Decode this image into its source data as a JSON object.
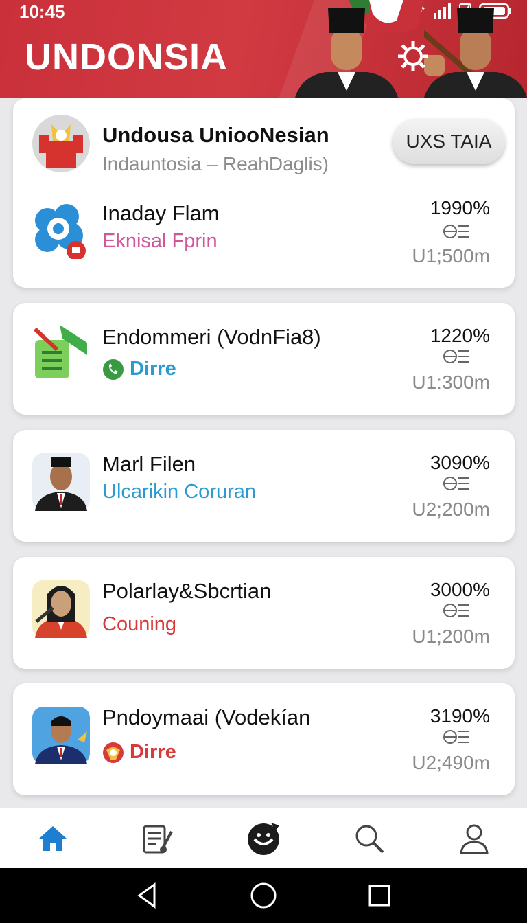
{
  "status": {
    "time": "10:45"
  },
  "header": {
    "title": "UNDONSIA"
  },
  "colors": {
    "header_red": "#c9303a",
    "pink": "#d0569a",
    "blue": "#2a9bd0",
    "red": "#d63a3a",
    "nav_blue": "#1e7fd1"
  },
  "profile": {
    "name": "Undousa UniooNesian",
    "subtitle": "Indauntosia – ReahDaglis)",
    "button_label": "UXS TAIA"
  },
  "items": [
    {
      "name": "Inaday Flam",
      "sub": "Eknisal Fprin",
      "pct": "1990%",
      "amount": "U1;500m",
      "icon": "gear-badge-icon"
    },
    {
      "name": "Endommeri (VodnFia8)",
      "sub": "Dirre",
      "pct": "1220%",
      "amount": "U1:300m",
      "icon": "document-icon"
    },
    {
      "name": "Marl Filen",
      "sub": "Ulcarikin Coruran",
      "pct": "3090%",
      "amount": "U2;200m",
      "icon": "person-avatar"
    },
    {
      "name": "Polarlay&Sbcrtian",
      "sub": "Couning",
      "pct": "3000%",
      "amount": "U1;200m",
      "icon": "person-avatar"
    },
    {
      "name": "Pndoymaai (Vodekían",
      "sub": "Dirre",
      "pct": "3190%",
      "amount": "U2;490m",
      "icon": "person-avatar"
    }
  ],
  "nav": [
    "home",
    "documents",
    "badge",
    "search",
    "profile"
  ]
}
